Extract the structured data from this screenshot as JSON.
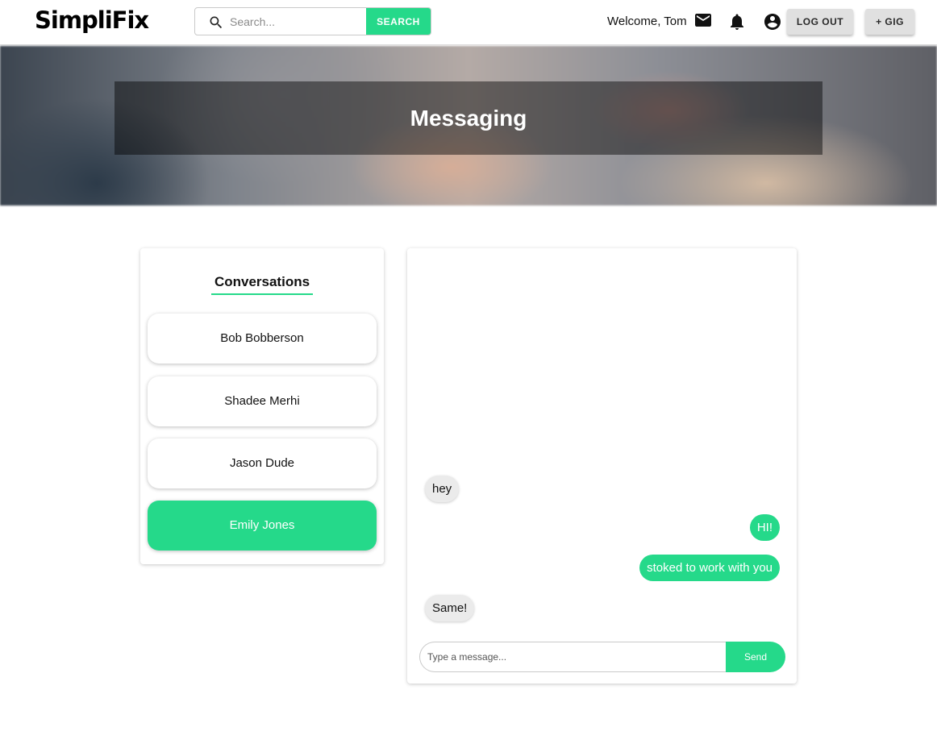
{
  "header": {
    "logo": "SimpliFix",
    "search": {
      "placeholder": "Search...",
      "button_label": "SEARCH"
    },
    "welcome": "Welcome, Tom",
    "logout_label": "LOG OUT",
    "gig_label": "+ GIG",
    "icons": [
      "mail-icon",
      "bell-icon",
      "account-circle-icon",
      "search-icon"
    ]
  },
  "hero": {
    "title": "Messaging"
  },
  "conversations": {
    "title": "Conversations",
    "items": [
      {
        "name": "Bob Bobberson",
        "active": false
      },
      {
        "name": "Shadee Merhi",
        "active": false
      },
      {
        "name": "Jason Dude",
        "active": false
      },
      {
        "name": "Emily Jones",
        "active": true
      }
    ]
  },
  "chat": {
    "messages": [
      {
        "text": "hey",
        "direction": "incoming"
      },
      {
        "text": "HI!",
        "direction": "outgoing"
      },
      {
        "text": "stoked to work with you",
        "direction": "outgoing"
      },
      {
        "text": "Same!",
        "direction": "incoming"
      }
    ],
    "input_placeholder": "Type a message...",
    "send_label": "Send"
  },
  "colors": {
    "accent": "#25d98a",
    "incoming_bubble": "#ebebeb",
    "button_gray": "#e0e0e0"
  }
}
